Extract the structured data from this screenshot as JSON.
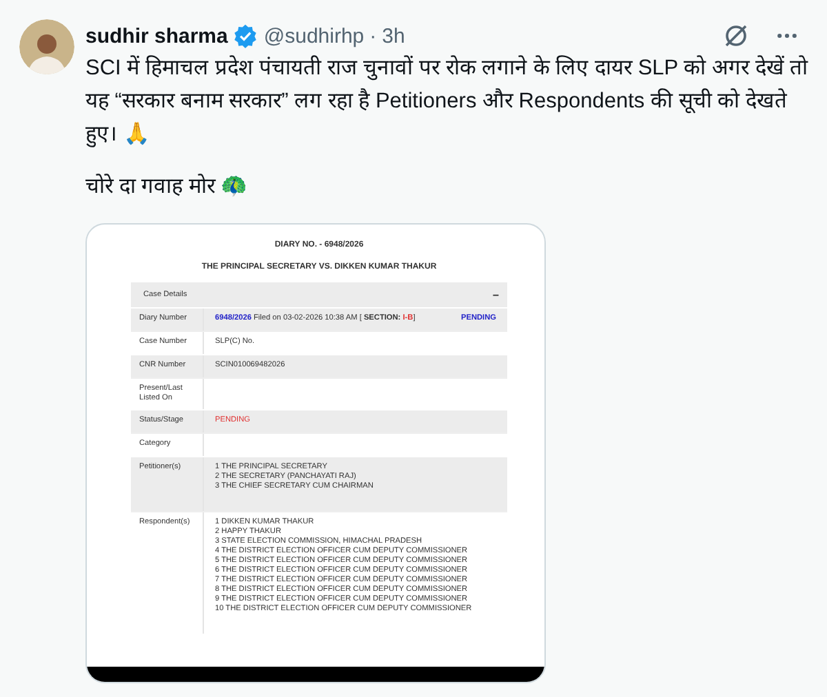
{
  "tweet": {
    "author": "sudhir sharma",
    "verified": true,
    "handle": "@sudhirhp",
    "separator": "·",
    "time": "3h",
    "paragraphs": [
      "SCI में हिमाचल प्रदेश पंचायती राज चुनावों पर रोक लगाने के लिए दायर SLP को अगर देखें तो यह “सरकार बनाम सरकार” लग रहा है Petitioners और Respondents की सूची को देखते हुए। 🙏",
      "चोरे दा गवाह मोर 🦚"
    ]
  },
  "document": {
    "title": "DIARY NO. - 6948/2026",
    "subtitle": "THE PRINCIPAL SECRETARY VS. DIKKEN KUMAR THAKUR",
    "section": {
      "label": "Case Details",
      "toggle": "−"
    },
    "rows": [
      {
        "kind": "diary",
        "label": "Diary Number",
        "number": "6948/2026",
        "filed": "Filed on 03-02-2026 10:38 AM [",
        "section_label": "SECTION:",
        "section_value": "I-B",
        "close": "]",
        "status": "PENDING"
      },
      {
        "kind": "text",
        "label": "Case Number",
        "value": "SLP(C) No."
      },
      {
        "kind": "text",
        "label": "CNR Number",
        "value": "SCIN010069482026"
      },
      {
        "kind": "text",
        "label": "Present/Last Listed On"
      },
      {
        "kind": "status",
        "label": "Status/Stage",
        "value": "PENDING"
      },
      {
        "kind": "text",
        "label": "Category"
      },
      {
        "kind": "list",
        "label": "Petitioner(s)",
        "items": [
          "1 THE PRINCIPAL SECRETARY",
          "2 THE SECRETARY (PANCHAYATI RAJ)",
          "3 THE CHIEF SECRETARY CUM CHAIRMAN"
        ]
      },
      {
        "kind": "list",
        "label": "Respondent(s)",
        "items": [
          "1 DIKKEN KUMAR THAKUR",
          "2 HAPPY THAKUR",
          "3 STATE ELECTION COMMISSION, HIMACHAL PRADESH",
          "4 THE DISTRICT ELECTION OFFICER CUM DEPUTY COMMISSIONER",
          "5 THE DISTRICT ELECTION OFFICER CUM DEPUTY COMMISSIONER",
          "6 THE DISTRICT ELECTION OFFICER CUM DEPUTY COMMISSIONER",
          "7 THE DISTRICT ELECTION OFFICER CUM DEPUTY COMMISSIONER",
          "8 THE DISTRICT ELECTION OFFICER CUM DEPUTY COMMISSIONER",
          "9 THE DISTRICT ELECTION OFFICER CUM DEPUTY COMMISSIONER",
          "10 THE DISTRICT ELECTION OFFICER CUM DEPUTY COMMISSIONER"
        ]
      }
    ]
  }
}
